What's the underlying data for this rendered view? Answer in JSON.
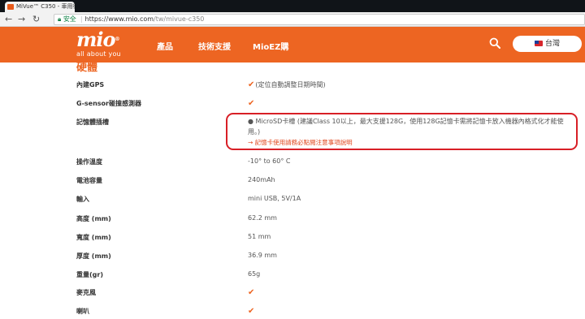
{
  "browser": {
    "tab_title": "MiVue™ C350 - 車用行",
    "nav_icons": [
      "back-icon",
      "forward-icon",
      "reload-icon"
    ],
    "secure_label": "安全",
    "url_domain": "https://www.mio.com",
    "url_path": "/tw/mivue-c350"
  },
  "header": {
    "logo_mark": "mio",
    "logo_tagline": "all about you",
    "nav": [
      "產品",
      "技術支援",
      "MioEZ購"
    ],
    "region_label": "台灣",
    "accent_color": "#ed6522"
  },
  "section_title": "硬體",
  "specs": {
    "gps": {
      "label": "內建GPS",
      "value": "(定位自動調整日期時間)"
    },
    "gsensor": {
      "label": "G-sensor碰撞感測器"
    },
    "memory": {
      "label": "記憶體插槽",
      "value": "● MicroSD卡槽 (建議Class 10以上，最大支援128G，使用128G記憶卡需將記憶卡放入機器內格式化才能使用。)",
      "link": "→ 記憶卡使用請務必點閱注意事項說明"
    },
    "temp": {
      "label": "操作溫度",
      "value": "-10° to 60° C"
    },
    "battery": {
      "label": "電池容量",
      "value": "240mAh"
    },
    "input": {
      "label": "輸入",
      "value": "mini USB, 5V/1A"
    },
    "height": {
      "label": "高度 (mm)",
      "value": "62.2 mm"
    },
    "width": {
      "label": "寬度 (mm)",
      "value": "51 mm"
    },
    "depth": {
      "label": "厚度 (mm)",
      "value": "36.9 mm"
    },
    "weight": {
      "label": "重量(gr)",
      "value": "65g"
    },
    "mic": {
      "label": "麥克風"
    },
    "speaker": {
      "label": "喇叭"
    }
  },
  "check_glyph": "✔"
}
